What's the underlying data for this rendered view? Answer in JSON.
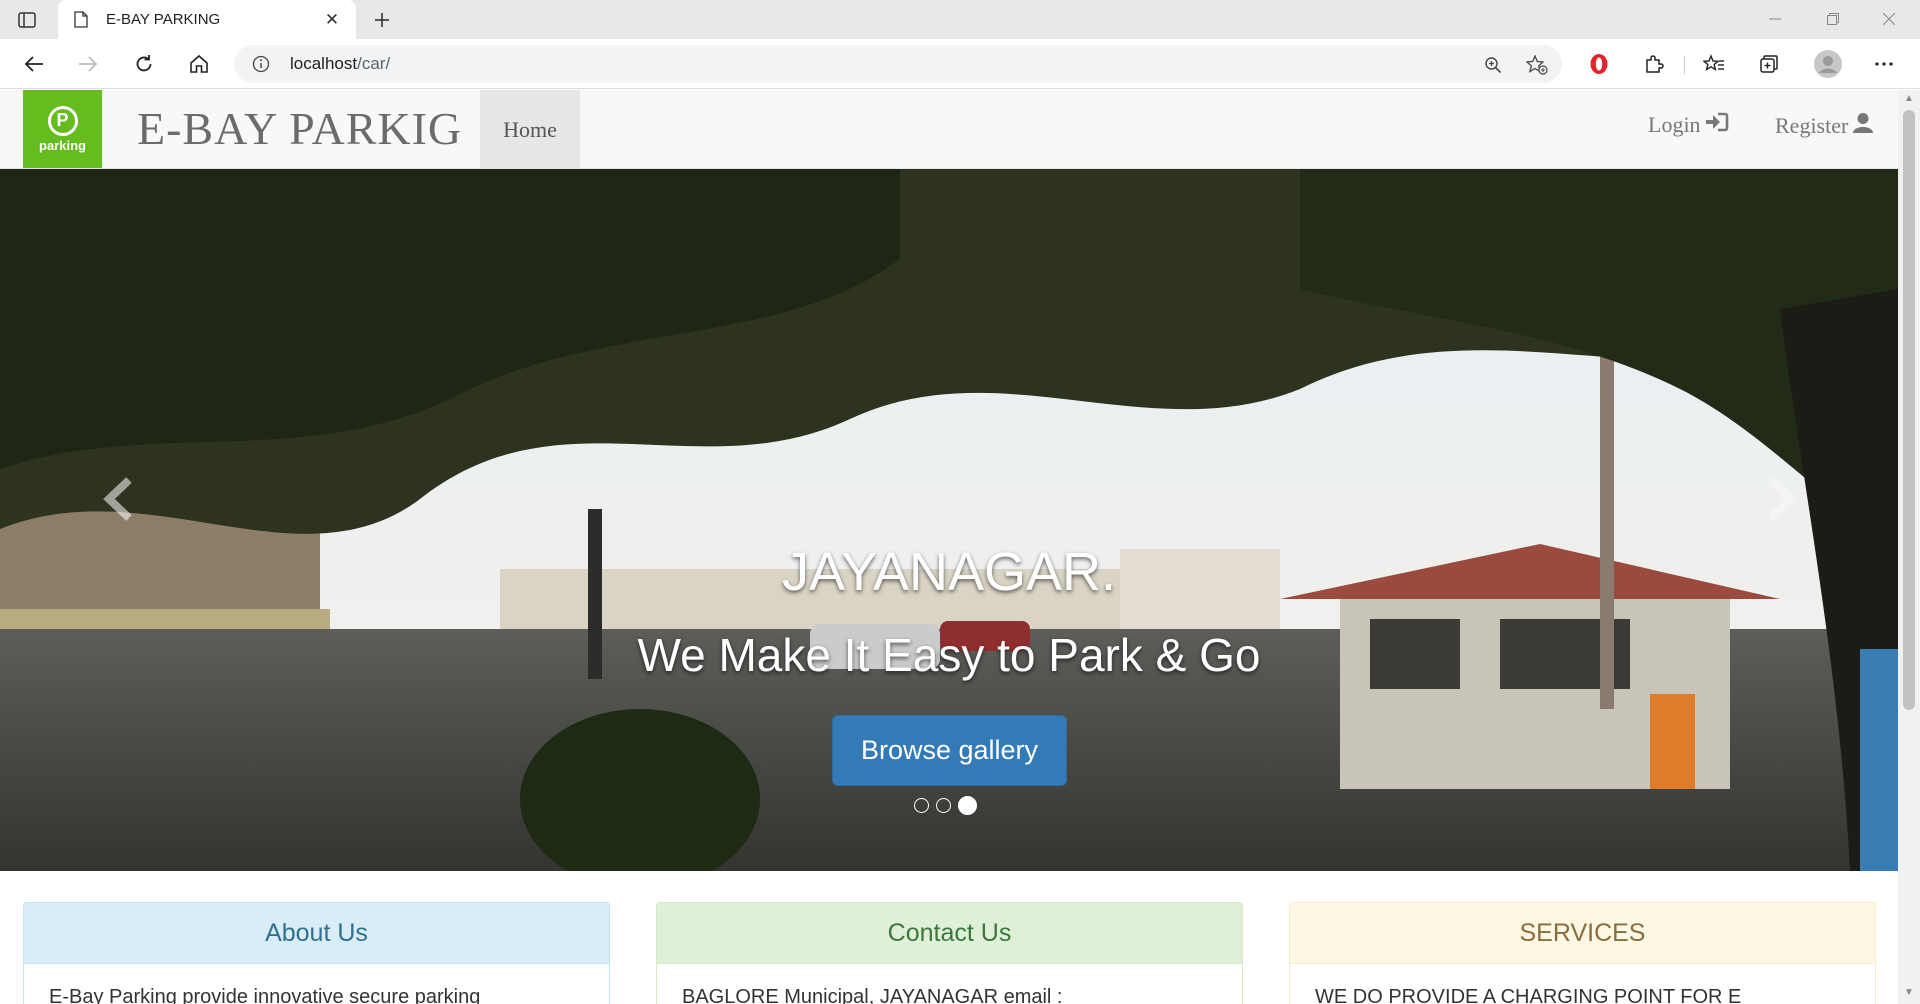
{
  "browser": {
    "tab_title": "E-BAY PARKING",
    "url_host": "localhost",
    "url_path": "/car/"
  },
  "navbar": {
    "logo_text": "parking",
    "brand": "E-BAY PARKIG",
    "home": "Home",
    "login": "Login",
    "register": "Register"
  },
  "carousel": {
    "heading": "JAYANAGAR.",
    "subheading": "We Make It Easy to Park & Go",
    "button": "Browse gallery",
    "slide_count": 3,
    "active_slide": 3
  },
  "panels": [
    {
      "title": "About Us",
      "body": "E-Bay Parking provide innovative secure parking",
      "header_bg": "#d9edf7",
      "color": "#31708f",
      "border": "#bce8f1"
    },
    {
      "title": "Contact Us",
      "body": "BAGLORE Municipal, JAYANAGAR email :",
      "header_bg": "#dff0d8",
      "color": "#3c763d",
      "border": "#d6e9c6"
    },
    {
      "title": "SERVICES",
      "body": "WE DO PROVIDE A CHARGING POINT FOR E",
      "header_bg": "#fcf8e3",
      "color": "#8a6d3b",
      "border": "#faebcc"
    }
  ],
  "icons": [
    "sidebar-toggle-icon",
    "document-icon",
    "close-icon",
    "plus-icon",
    "back-icon",
    "forward-icon",
    "reload-icon",
    "home-icon",
    "info-icon",
    "zoom-icon",
    "favorite-add-icon",
    "opera-icon",
    "extensions-icon",
    "favorites-icon",
    "collections-icon",
    "profile-icon",
    "more-icon",
    "login-icon",
    "user-icon",
    "chevron-left-icon",
    "chevron-right-icon"
  ]
}
